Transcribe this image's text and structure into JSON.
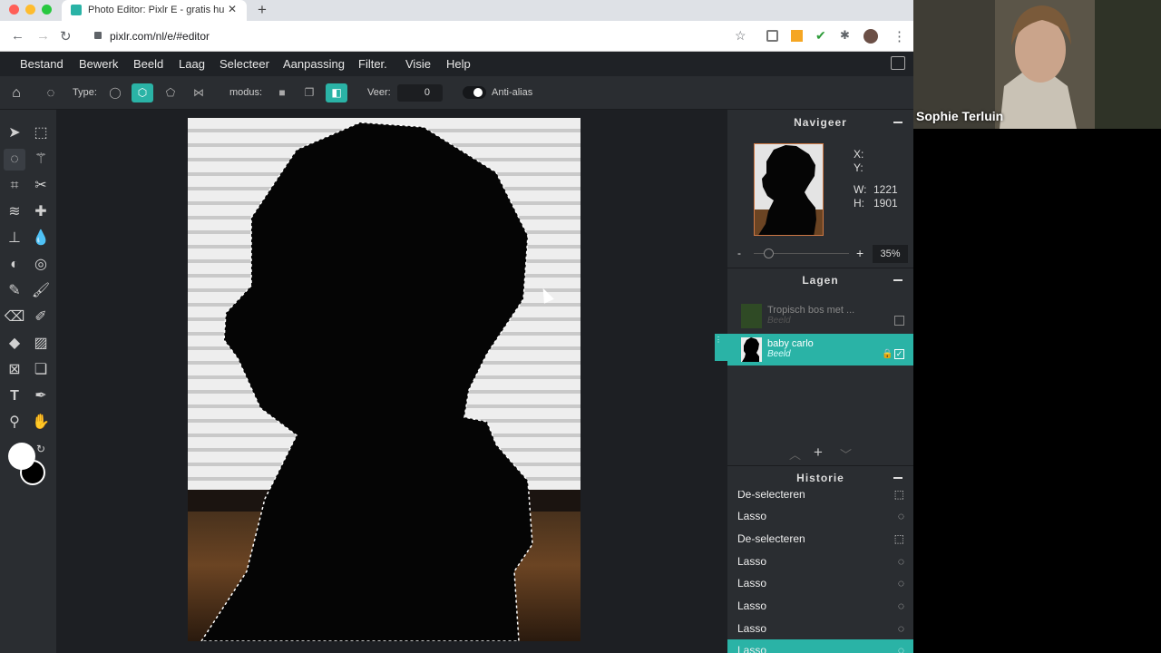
{
  "browser": {
    "tab_title": "Photo Editor: Pixlr E - gratis hu",
    "url": "pixlr.com/nl/e/#editor",
    "colors": {
      "close": "#ff5f57",
      "minimize": "#febc2e",
      "maximize": "#28c840"
    }
  },
  "menu": [
    "Bestand",
    "Bewerk",
    "Beeld",
    "Laag",
    "Selecteer",
    "Aanpassing",
    "Filter.",
    "Visie",
    "Help"
  ],
  "tool_options": {
    "type_label": "Type:",
    "modus_label": "modus:",
    "veer_label": "Veer:",
    "veer_value": "0",
    "antialias_label": "Anti-alias"
  },
  "navigator": {
    "title": "Navigeer",
    "x_label": "X:",
    "y_label": "Y:",
    "w_label": "W:",
    "w_value": "1221",
    "h_label": "H:",
    "h_value": "1901",
    "zoom_minus": "-",
    "zoom_plus": "+",
    "zoom_value": "35%"
  },
  "layers": {
    "title": "Lagen",
    "items": [
      {
        "name": "Tropisch bos met ...",
        "type": "Beeld"
      },
      {
        "name": "baby carlo",
        "type": "Beeld"
      }
    ],
    "add": "+"
  },
  "history": {
    "title": "Historie",
    "items": [
      {
        "label": "De-selecteren",
        "icon": "marquee-icon"
      },
      {
        "label": "Lasso",
        "icon": "lasso-icon"
      },
      {
        "label": "De-selecteren",
        "icon": "marquee-icon"
      },
      {
        "label": "Lasso",
        "icon": "lasso-icon"
      },
      {
        "label": "Lasso",
        "icon": "lasso-icon"
      },
      {
        "label": "Lasso",
        "icon": "lasso-icon"
      },
      {
        "label": "Lasso",
        "icon": "lasso-icon"
      },
      {
        "label": "Lasso",
        "icon": "lasso-icon"
      }
    ]
  },
  "webcam": {
    "name": "Sophie Terluin"
  },
  "accent": "#2ab3a6"
}
